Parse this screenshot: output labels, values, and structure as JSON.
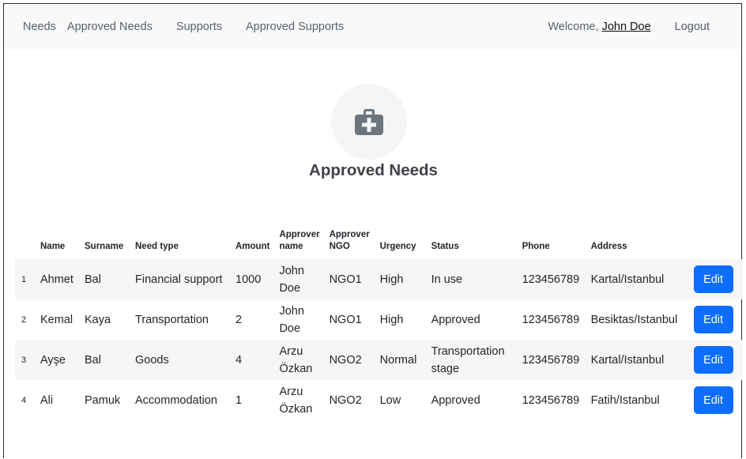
{
  "nav": {
    "links": [
      "Needs",
      "Approved Needs",
      "Supports",
      "Approved Supports"
    ],
    "welcome_label": "Welcome,",
    "user_name": "John Doe",
    "logout_label": "Logout"
  },
  "hero": {
    "icon": "medical-kit-icon",
    "title": "Approved Needs"
  },
  "table": {
    "headers": [
      "",
      "Name",
      "Surname",
      "Need type",
      "Amount",
      "Approver name",
      "Approver NGO",
      "Urgency",
      "Status",
      "Phone",
      "Address",
      ""
    ],
    "rows": [
      {
        "num": "1",
        "name": "Ahmet",
        "surname": "Bal",
        "need_type": "Financial support",
        "amount": "1000",
        "approver_name": "John Doe",
        "ngo": "NGO1",
        "urgency": "High",
        "status": "In use",
        "phone": "123456789",
        "address": "Kartal/Istanbul",
        "action": "Edit"
      },
      {
        "num": "2",
        "name": "Kemal",
        "surname": "Kaya",
        "need_type": "Transportation",
        "amount": "2",
        "approver_name": "John Doe",
        "ngo": "NGO1",
        "urgency": "High",
        "status": "Approved",
        "phone": "123456789",
        "address": "Besiktas/Istanbul",
        "action": "Edit"
      },
      {
        "num": "3",
        "name": "Ayşe",
        "surname": "Bal",
        "need_type": "Goods",
        "amount": "4",
        "approver_name": "Arzu Özkan",
        "ngo": "NGO2",
        "urgency": "Normal",
        "status": "Transportation stage",
        "phone": "123456789",
        "address": "Kartal/Istanbul",
        "action": "Edit"
      },
      {
        "num": "4",
        "name": "Ali",
        "surname": "Pamuk",
        "need_type": "Accommodation",
        "amount": "1",
        "approver_name": "Arzu Özkan",
        "ngo": "NGO2",
        "urgency": "Low",
        "status": "Approved",
        "phone": "123456789",
        "address": "Fatih/Istanbul",
        "action": "Edit"
      }
    ]
  },
  "colors": {
    "navbar_bg": "#f8f9fa",
    "primary": "#0d6efd",
    "stripe": "#f6f6f6",
    "icon": "#6c757d"
  }
}
